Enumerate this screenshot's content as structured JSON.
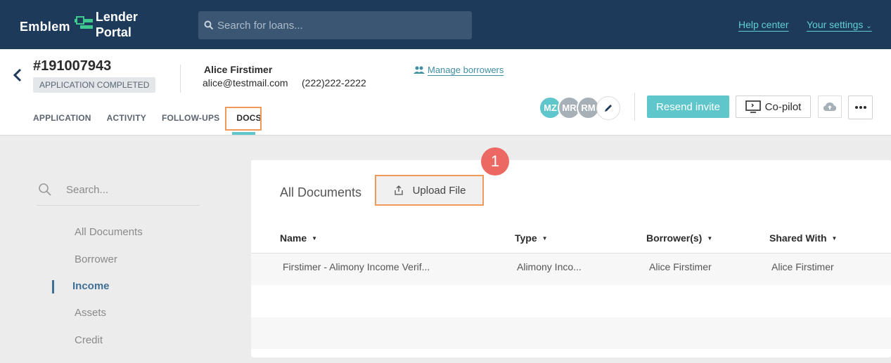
{
  "topbar": {
    "brand_left": "Emblem",
    "brand_line1": "Lender",
    "brand_line2": "Portal",
    "search_placeholder": "Search for loans...",
    "help_center": "Help center",
    "your_settings": "Your settings"
  },
  "loan": {
    "id": "#191007943",
    "status": "APPLICATION COMPLETED",
    "borrower_name": "Alice Firstimer",
    "borrower_email": "alice@testmail.com",
    "borrower_phone": "(222)222-2222",
    "manage_borrowers": "Manage borrowers"
  },
  "tabs": [
    {
      "label": "APPLICATION"
    },
    {
      "label": "ACTIVITY"
    },
    {
      "label": "FOLLOW-UPS"
    },
    {
      "label": "DOCS"
    }
  ],
  "avatars": [
    {
      "initials": "MZ",
      "color": "#5fc6cc"
    },
    {
      "initials": "MR",
      "color": "#a7afb7"
    },
    {
      "initials": "RM",
      "color": "#a7afb7"
    }
  ],
  "actions": {
    "resend_invite": "Resend invite",
    "copilot": "Co-pilot"
  },
  "sidebar": {
    "search_placeholder": "Search...",
    "items": [
      {
        "label": "All Documents"
      },
      {
        "label": "Borrower"
      },
      {
        "label": "Income"
      },
      {
        "label": "Assets"
      },
      {
        "label": "Credit"
      }
    ]
  },
  "documents": {
    "title": "All Documents",
    "upload_label": "Upload File",
    "step_badge": "1",
    "columns": [
      "Name",
      "Type",
      "Borrower(s)",
      "Shared With"
    ],
    "rows": [
      {
        "name": "Firstimer - Alimony Income Verif...",
        "type": "Alimony Inco...",
        "borrowers": "Alice Firstimer",
        "shared_with": "Alice Firstimer"
      }
    ]
  },
  "colors": {
    "topbar": "#1e3a5a",
    "accent": "#5fc6cc",
    "highlight": "#f09a5a",
    "badge": "#ec6862"
  }
}
